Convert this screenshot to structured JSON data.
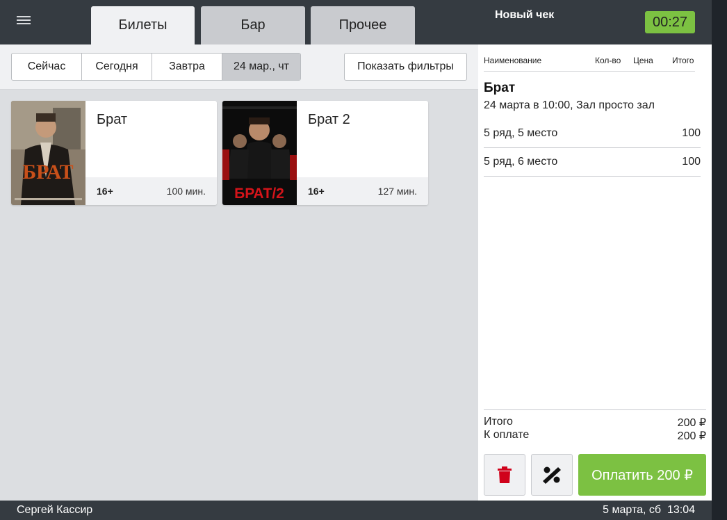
{
  "tabs": [
    {
      "label": "Билеты",
      "active": true
    },
    {
      "label": "Бар",
      "active": false
    },
    {
      "label": "Прочее",
      "active": false
    }
  ],
  "date_filter": {
    "options": [
      "Сейчас",
      "Сегодня",
      "Завтра",
      "24 мар., чт"
    ],
    "selected": "24 мар., чт"
  },
  "show_filters_label": "Показать фильтры",
  "movies": [
    {
      "title": "Брат",
      "age": "16+",
      "duration": "100 мин.",
      "poster_text": "БРАТ"
    },
    {
      "title": "Брат 2",
      "age": "16+",
      "duration": "127 мин.",
      "poster_text": "БРАТ/2"
    }
  ],
  "receipt": {
    "title": "Новый чек",
    "timer": "00:27",
    "columns": {
      "name": "Наименование",
      "qty": "Кол-во",
      "price": "Цена",
      "total": "Итого"
    },
    "item_title": "Брат",
    "item_subtitle": "24 марта в 10:00, Зал просто зал",
    "lines": [
      {
        "label": "5 ряд, 5 место",
        "amount": "100"
      },
      {
        "label": "5 ряд, 6 место",
        "amount": "100"
      }
    ],
    "total_label": "Итого",
    "total_value": "200 ₽",
    "to_pay_label": "К оплате",
    "to_pay_value": "200 ₽",
    "pay_button": "Оплатить 200 ₽"
  },
  "status": {
    "user": "Сергей Кассир",
    "datetime": "5 марта, сб  13:04"
  },
  "colors": {
    "accent_green": "#7cc142",
    "dark_bar": "#353b41",
    "delete_red": "#d0021b"
  }
}
